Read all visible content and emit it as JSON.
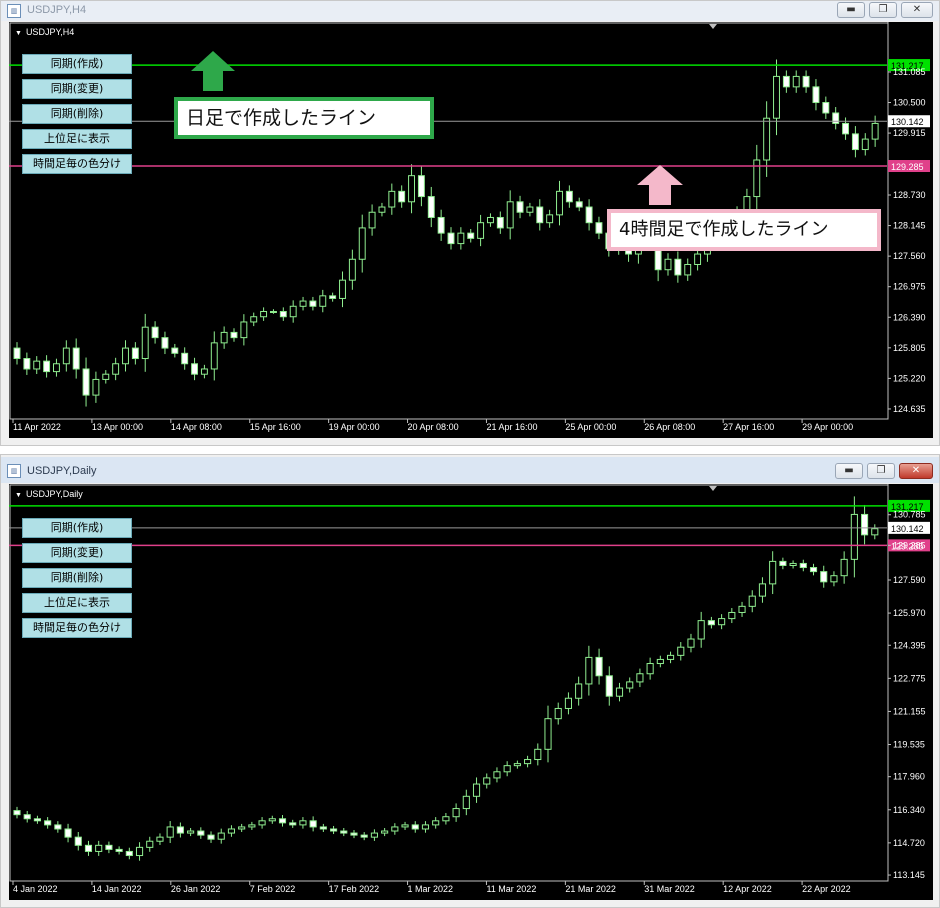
{
  "top_window": {
    "title": "USDJPY,H4",
    "chart_label": "USDJPY,H4",
    "buttons": [
      "同期(作成)",
      "同期(変更)",
      "同期(削除)",
      "上位足に表示",
      "時間足毎の色分け"
    ],
    "annotation_green": "日足で作成したライン",
    "annotation_pink": "4時間足で作成したライン"
  },
  "bottom_window": {
    "title": "USDJPY,Daily",
    "chart_label": "USDJPY,Daily",
    "buttons": [
      "同期(作成)",
      "同期(変更)",
      "同期(削除)",
      "上位足に表示",
      "時間足毎の色分け"
    ]
  },
  "window_controls": {
    "minimize": "▬",
    "restore": "❐",
    "close": "✕"
  },
  "colors": {
    "green_line": "#00e000",
    "pink_line": "#e0408a",
    "grey_line": "#9a9a9a",
    "candle": "#90ee90",
    "candle_body_bull": "#000000",
    "candle_body_bear": "#ffffff",
    "button_bg": "#b0e0e6"
  },
  "chart_data": [
    {
      "type": "candlestick",
      "symbol": "USDJPY",
      "timeframe": "H4",
      "x_ticks": [
        "11 Apr 2022",
        "13 Apr 00:00",
        "14 Apr 08:00",
        "15 Apr 16:00",
        "19 Apr 00:00",
        "20 Apr 08:00",
        "21 Apr 16:00",
        "25 Apr 00:00",
        "26 Apr 08:00",
        "27 Apr 16:00",
        "29 Apr 00:00"
      ],
      "y_ticks": [
        131.085,
        130.5,
        129.915,
        128.73,
        128.145,
        127.56,
        126.975,
        126.39,
        125.805,
        125.22,
        124.635
      ],
      "ylim": [
        124.5,
        131.85
      ],
      "hlines": [
        {
          "value": 131.217,
          "label": "131.217",
          "color": "#00e000"
        },
        {
          "value": 130.142,
          "label": "130.142",
          "color": "#9a9a9a"
        },
        {
          "value": 129.285,
          "label": "129.285",
          "color": "#e0408a"
        }
      ],
      "closes": [
        125.6,
        125.4,
        125.55,
        125.35,
        125.5,
        125.8,
        125.4,
        124.9,
        125.2,
        125.3,
        125.5,
        125.8,
        125.6,
        126.2,
        126.0,
        125.8,
        125.7,
        125.5,
        125.3,
        125.4,
        125.9,
        126.1,
        126.0,
        126.3,
        126.4,
        126.5,
        126.5,
        126.4,
        126.6,
        126.7,
        126.6,
        126.8,
        126.75,
        127.1,
        127.5,
        128.1,
        128.4,
        128.5,
        128.8,
        128.6,
        129.1,
        128.7,
        128.3,
        128.0,
        127.8,
        128.0,
        127.9,
        128.2,
        128.3,
        128.1,
        128.6,
        128.4,
        128.5,
        128.2,
        128.35,
        128.8,
        128.6,
        128.5,
        128.2,
        128.0,
        127.7,
        127.9,
        127.6,
        128.0,
        127.8,
        127.3,
        127.5,
        127.2,
        127.4,
        127.6,
        127.9,
        128.1,
        128.2,
        128.4,
        128.7,
        129.4,
        130.2,
        131.0,
        130.8,
        131.0,
        130.8,
        130.5,
        130.3,
        130.1,
        129.9,
        129.6,
        129.8,
        130.1
      ]
    },
    {
      "type": "candlestick",
      "symbol": "USDJPY",
      "timeframe": "Daily",
      "x_ticks": [
        "4 Jan 2022",
        "14 Jan 2022",
        "26 Jan 2022",
        "7 Feb 2022",
        "17 Feb 2022",
        "1 Mar 2022",
        "11 Mar 2022",
        "21 Mar 2022",
        "31 Mar 2022",
        "12 Apr 2022",
        "22 Apr 2022"
      ],
      "y_ticks": [
        130.785,
        129.285,
        127.59,
        125.97,
        124.395,
        122.775,
        121.155,
        119.535,
        117.96,
        116.34,
        114.72,
        113.145
      ],
      "ylim": [
        113.0,
        131.8
      ],
      "hlines": [
        {
          "value": 131.217,
          "label": "131.217",
          "color": "#00e000"
        },
        {
          "value": 130.142,
          "label": "130.142",
          "color": "#9a9a9a"
        },
        {
          "value": 129.285,
          "label": "129.285",
          "color": "#e0408a"
        }
      ],
      "closes": [
        116.1,
        115.9,
        115.8,
        115.6,
        115.4,
        115.0,
        114.6,
        114.3,
        114.6,
        114.4,
        114.3,
        114.1,
        114.5,
        114.8,
        115.0,
        115.5,
        115.2,
        115.3,
        115.1,
        114.9,
        115.2,
        115.4,
        115.5,
        115.6,
        115.8,
        115.9,
        115.7,
        115.6,
        115.8,
        115.5,
        115.4,
        115.3,
        115.2,
        115.1,
        115.0,
        115.2,
        115.3,
        115.5,
        115.6,
        115.4,
        115.6,
        115.8,
        116.0,
        116.4,
        117.0,
        117.6,
        117.9,
        118.2,
        118.5,
        118.6,
        118.8,
        119.3,
        120.8,
        121.3,
        121.8,
        122.5,
        123.8,
        122.9,
        121.9,
        122.3,
        122.6,
        123.0,
        123.5,
        123.7,
        123.9,
        124.3,
        124.7,
        125.6,
        125.4,
        125.7,
        126.0,
        126.3,
        126.8,
        127.4,
        128.5,
        128.3,
        128.4,
        128.2,
        128.0,
        127.5,
        127.8,
        128.6,
        130.8,
        129.8,
        130.1
      ]
    }
  ]
}
